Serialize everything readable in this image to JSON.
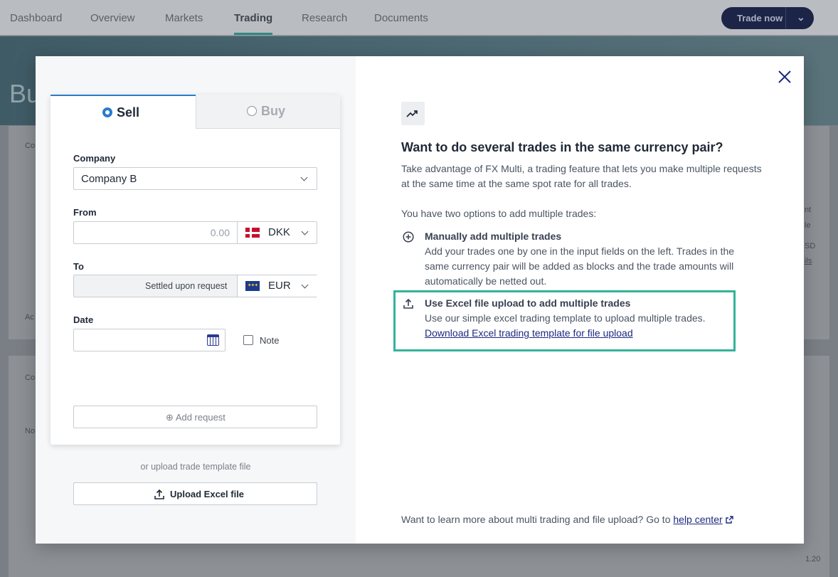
{
  "topnav": {
    "tabs": [
      "Dashboard",
      "Overview",
      "Markets",
      "Trading",
      "Research",
      "Documents"
    ],
    "active_tab": "Trading",
    "trade_now_label": "Trade now"
  },
  "background": {
    "page_title_fragment": "Bu",
    "fragments": [
      "Co",
      "Ac",
      "Co",
      "No",
      "1.20",
      "nt",
      "le",
      "SD",
      "ils"
    ]
  },
  "modal": {
    "tabs": {
      "sell": "Sell",
      "buy": "Buy",
      "selected": "Sell"
    },
    "form": {
      "company_label": "Company",
      "company_value": "Company B",
      "from_label": "From",
      "from_amount_placeholder": "0.00",
      "from_currency": "DKK",
      "to_label": "To",
      "to_placeholder": "Settled upon request",
      "to_currency": "EUR",
      "date_label": "Date",
      "date_value": "",
      "note_label": "Note",
      "add_request_label": "Add request"
    },
    "or_upload_text": "or upload trade template file",
    "upload_button_label": "Upload Excel file",
    "info": {
      "heading": "Want to do several trades in the same currency pair?",
      "intro": "Take advantage of FX Multi, a trading feature that lets you make multiple requests at the same time at the same spot rate for all trades.",
      "options_intro": "You have two options to add multiple trades:",
      "option1_title": "Manually add multiple trades",
      "option1_text": "Add your trades one by one in the input fields on the left. Trades in the same currency pair will be added as blocks and the trade amounts will automatically be netted out.",
      "option2_title": "Use Excel file upload to add multiple trades",
      "option2_text": "Use our simple excel trading template to upload multiple trades.",
      "option2_link": "Download Excel trading template for file upload",
      "footer_text": "Want to learn more about multi trading and file upload? Go to",
      "footer_link": "help center"
    },
    "colors": {
      "accent_blue": "#2c7bc9",
      "highlight_green": "#33b39a",
      "link_navy": "#1c2a80"
    }
  }
}
